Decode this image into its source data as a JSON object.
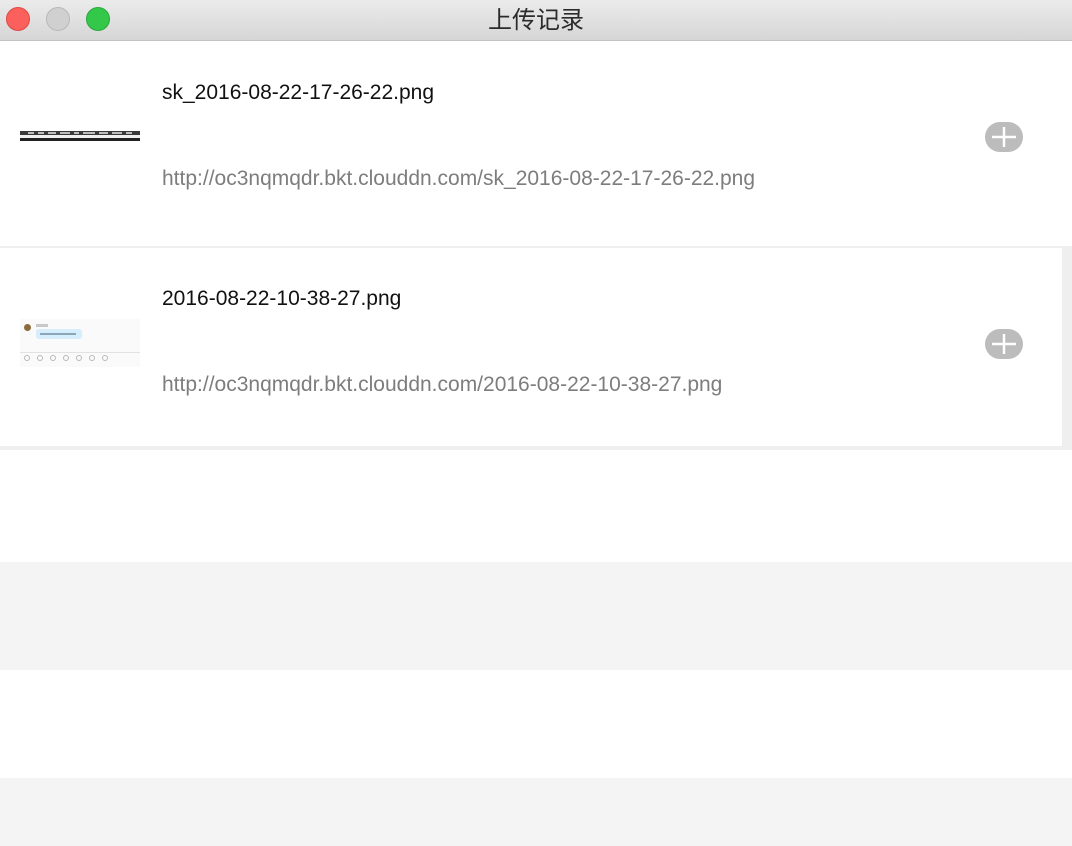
{
  "window": {
    "title": "上传记录"
  },
  "records": [
    {
      "filename": "sk_2016-08-22-17-26-22.png",
      "url": "http://oc3nqmqdr.bkt.clouddn.com/sk_2016-08-22-17-26-22.png",
      "thumbnail": "desktop-screenshot-thumbnail",
      "action_icon": "plus-icon"
    },
    {
      "filename": "2016-08-22-10-38-27.png",
      "url": "http://oc3nqmqdr.bkt.clouddn.com/2016-08-22-10-38-27.png",
      "thumbnail": "chat-screenshot-thumbnail",
      "action_icon": "plus-icon"
    }
  ],
  "colors": {
    "close": "#fc605c",
    "minimize": "#d0d0d0",
    "zoom": "#34c84a",
    "filename_text": "#111111",
    "url_text": "#7d7d7d",
    "add_button": "#bcbcbc",
    "alt_row": "#f4f4f4"
  }
}
